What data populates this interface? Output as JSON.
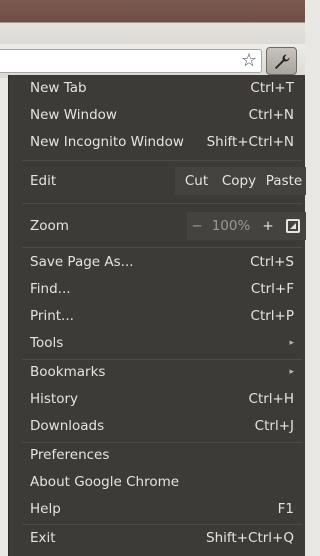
{
  "menu": {
    "new_tab": {
      "label": "New Tab",
      "shortcut": "Ctrl+T"
    },
    "new_window": {
      "label": "New Window",
      "shortcut": "Ctrl+N"
    },
    "new_incognito": {
      "label": "New Incognito Window",
      "shortcut": "Shift+Ctrl+N"
    },
    "edit": {
      "label": "Edit",
      "cut": "Cut",
      "copy": "Copy",
      "paste": "Paste"
    },
    "zoom": {
      "label": "Zoom",
      "minus": "−",
      "level": "100%",
      "plus": "+"
    },
    "save_page": {
      "label": "Save Page As...",
      "shortcut": "Ctrl+S"
    },
    "find": {
      "label": "Find...",
      "shortcut": "Ctrl+F"
    },
    "print": {
      "label": "Print...",
      "shortcut": "Ctrl+P"
    },
    "tools": {
      "label": "Tools",
      "arrow": "▸"
    },
    "bookmarks": {
      "label": "Bookmarks",
      "arrow": "▸"
    },
    "history": {
      "label": "History",
      "shortcut": "Ctrl+H"
    },
    "downloads": {
      "label": "Downloads",
      "shortcut": "Ctrl+J"
    },
    "preferences": {
      "label": "Preferences"
    },
    "about": {
      "label": "About Google Chrome"
    },
    "help": {
      "label": "Help",
      "shortcut": "F1"
    },
    "exit": {
      "label": "Exit",
      "shortcut": "Shift+Ctrl+Q"
    }
  },
  "toolbar": {
    "bookmark_star": "☆",
    "icons": [
      "star-icon",
      "wrench-icon"
    ]
  }
}
